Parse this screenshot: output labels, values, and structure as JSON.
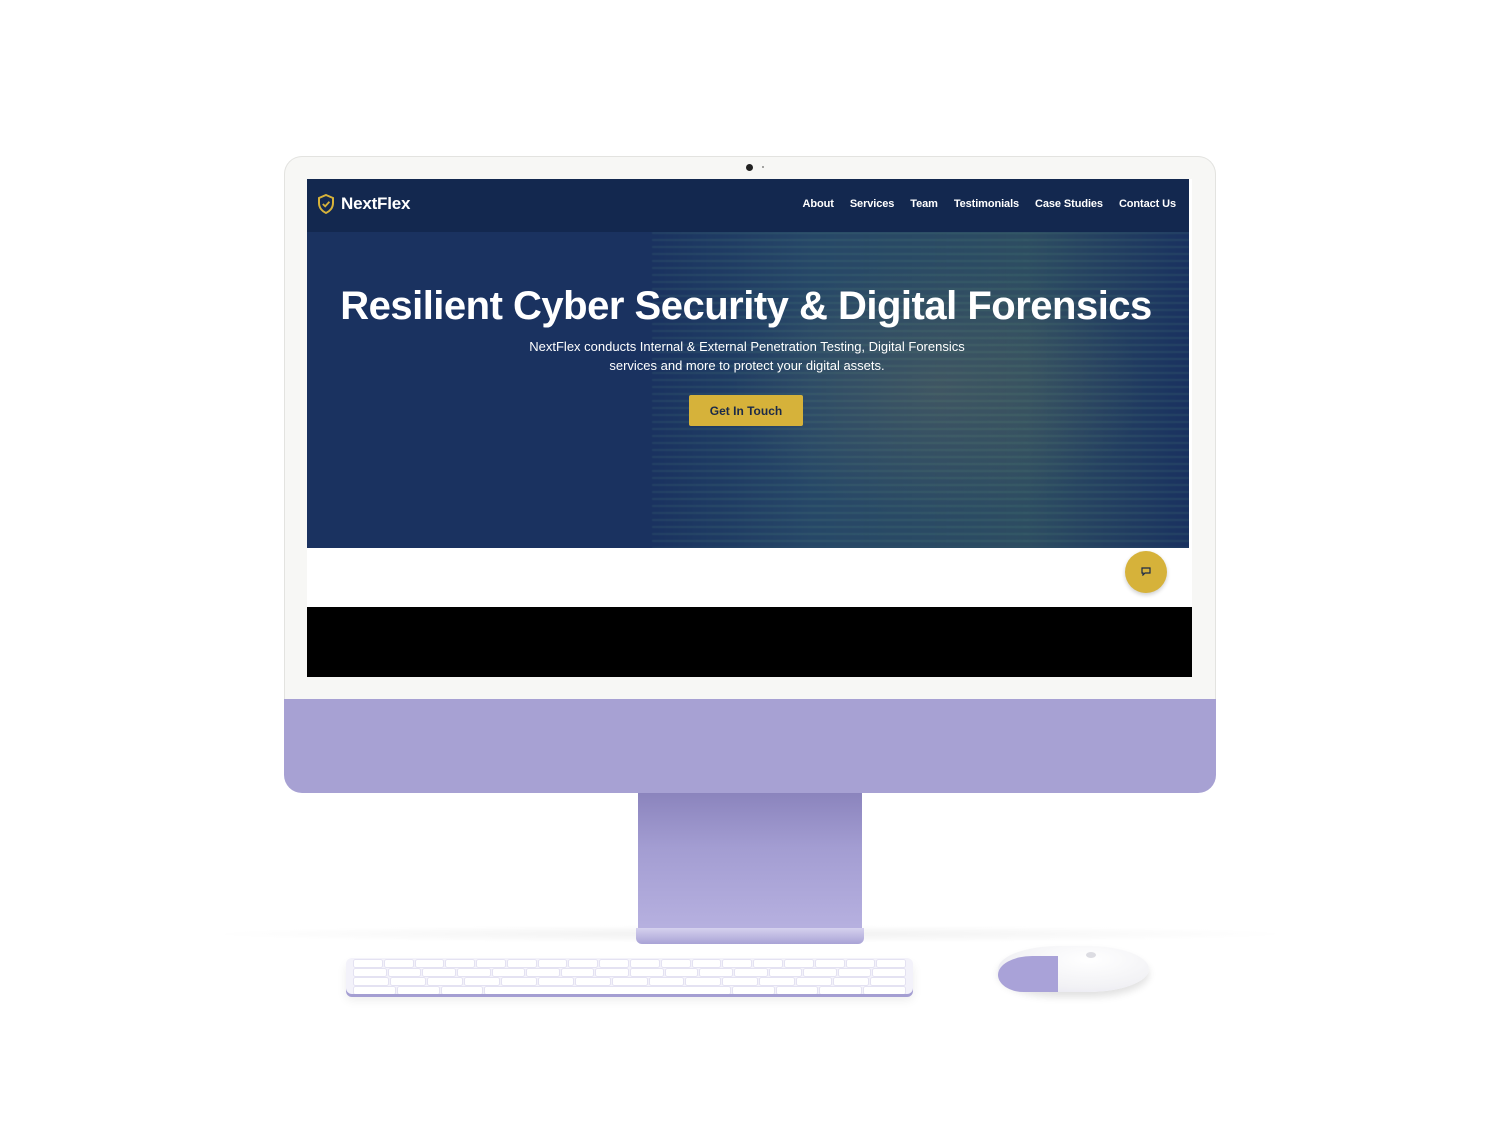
{
  "brand": {
    "name": "NextFlex"
  },
  "nav": {
    "items": [
      {
        "label": "About"
      },
      {
        "label": "Services"
      },
      {
        "label": "Team"
      },
      {
        "label": "Testimonials"
      },
      {
        "label": "Case Studies"
      },
      {
        "label": "Contact Us"
      }
    ]
  },
  "hero": {
    "title": "Resilient Cyber Security & Digital Forensics",
    "subtitle_line1": "NextFlex conducts Internal & External Penetration Testing, Digital Forensics",
    "subtitle_line2": "services and more to protect your digital assets.",
    "cta_label": "Get In Touch"
  },
  "icons": {
    "logo": "shield-check-icon",
    "chat": "chat-bubble-icon"
  },
  "colors": {
    "hero_bg": "#1a3260",
    "nav_bg": "#13284f",
    "accent": "#d6b23a",
    "device": "#a7a1d3"
  }
}
